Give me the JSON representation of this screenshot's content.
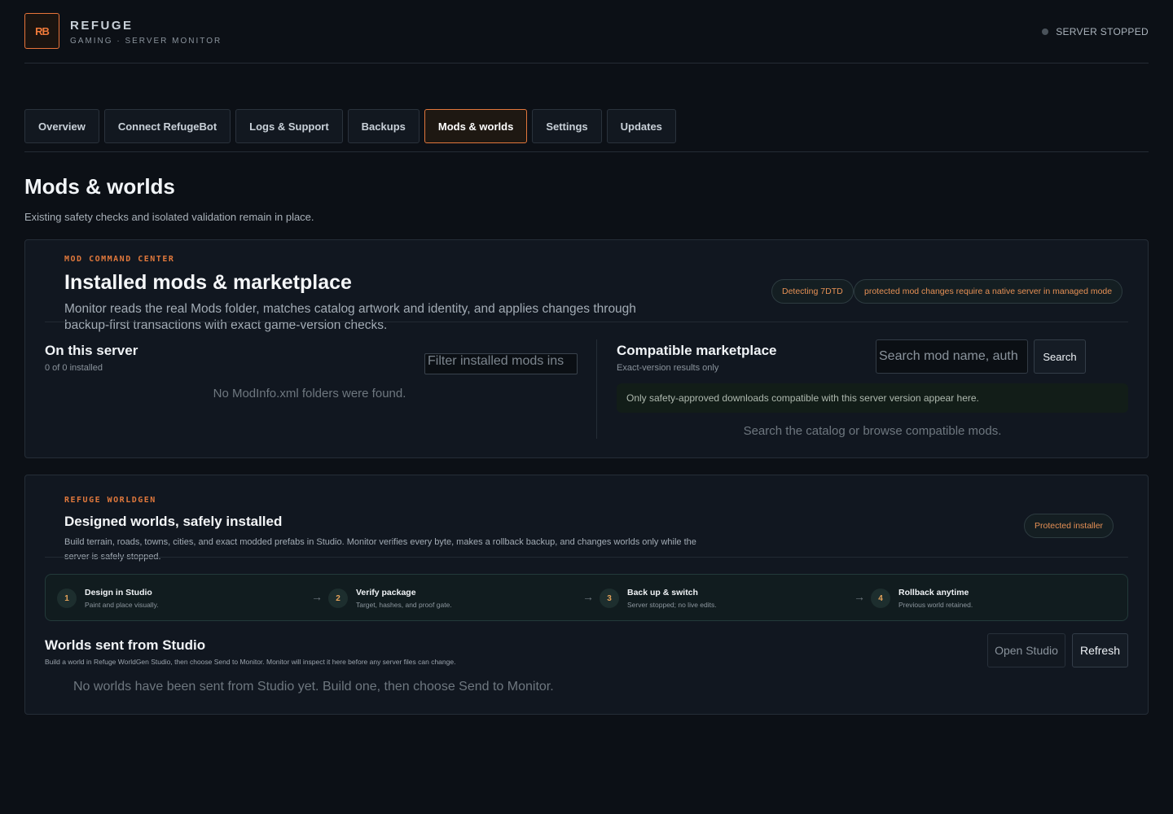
{
  "header": {
    "logo_text": "RB",
    "brand_title": "REFUGE",
    "brand_subtitle": "GAMING · SERVER MONITOR",
    "status_text": "SERVER STOPPED"
  },
  "tabs": [
    {
      "label": "Overview"
    },
    {
      "label": "Connect RefugeBot"
    },
    {
      "label": "Logs & Support"
    },
    {
      "label": "Backups"
    },
    {
      "label": "Mods & worlds",
      "active": true
    },
    {
      "label": "Settings"
    },
    {
      "label": "Updates"
    }
  ],
  "page": {
    "title": "Mods & worlds",
    "subtitle": "Existing safety checks and isolated validation remain in place."
  },
  "mods": {
    "eyebrow": "MOD COMMAND CENTER",
    "title": "Installed mods & marketplace",
    "description": "Monitor reads the real Mods folder, matches catalog artwork and identity, and applies changes through backup-first transactions with exact game-version checks.",
    "pill_detect": "Detecting 7DTD",
    "pill_protected": "protected mod changes require a native server in managed mode",
    "installed": {
      "title": "On this server",
      "count": "0 of 0 installed",
      "filter_placeholder": "Filter installed mods ins",
      "empty": "No ModInfo.xml folders were found."
    },
    "marketplace": {
      "title": "Compatible marketplace",
      "subtitle": "Exact-version results only",
      "search_placeholder": "Search mod name, auth",
      "search_button": "Search",
      "notice": "Only safety-approved downloads compatible with this server version appear here.",
      "empty": "Search the catalog or browse compatible mods."
    }
  },
  "worldgen": {
    "eyebrow": "REFUGE WORLDGEN",
    "title": "Designed worlds, safely installed",
    "description": "Build terrain, roads, towns, cities, and exact modded prefabs in Studio. Monitor verifies every byte, makes a rollback backup, and changes worlds only while the server is safely stopped.",
    "pill": "Protected installer",
    "steps": [
      {
        "num": "1",
        "title": "Design in Studio",
        "sub": "Paint and place visually."
      },
      {
        "num": "2",
        "title": "Verify package",
        "sub": "Target, hashes, and proof gate."
      },
      {
        "num": "3",
        "title": "Back up & switch",
        "sub": "Server stopped; no live edits."
      },
      {
        "num": "4",
        "title": "Rollback anytime",
        "sub": "Previous world retained."
      }
    ],
    "arrow": "→",
    "worlds": {
      "title": "Worlds sent from Studio",
      "subtitle": "Build a world in Refuge WorldGen Studio, then choose Send to Monitor. Monitor will inspect it here before any server files can change.",
      "open_studio": "Open Studio",
      "refresh": "Refresh",
      "empty": "No worlds have been sent from Studio yet. Build one, then choose Send to Monitor."
    }
  },
  "colors": {
    "accent": "#e2773c",
    "background": "#0c1016",
    "card": "#111720"
  }
}
